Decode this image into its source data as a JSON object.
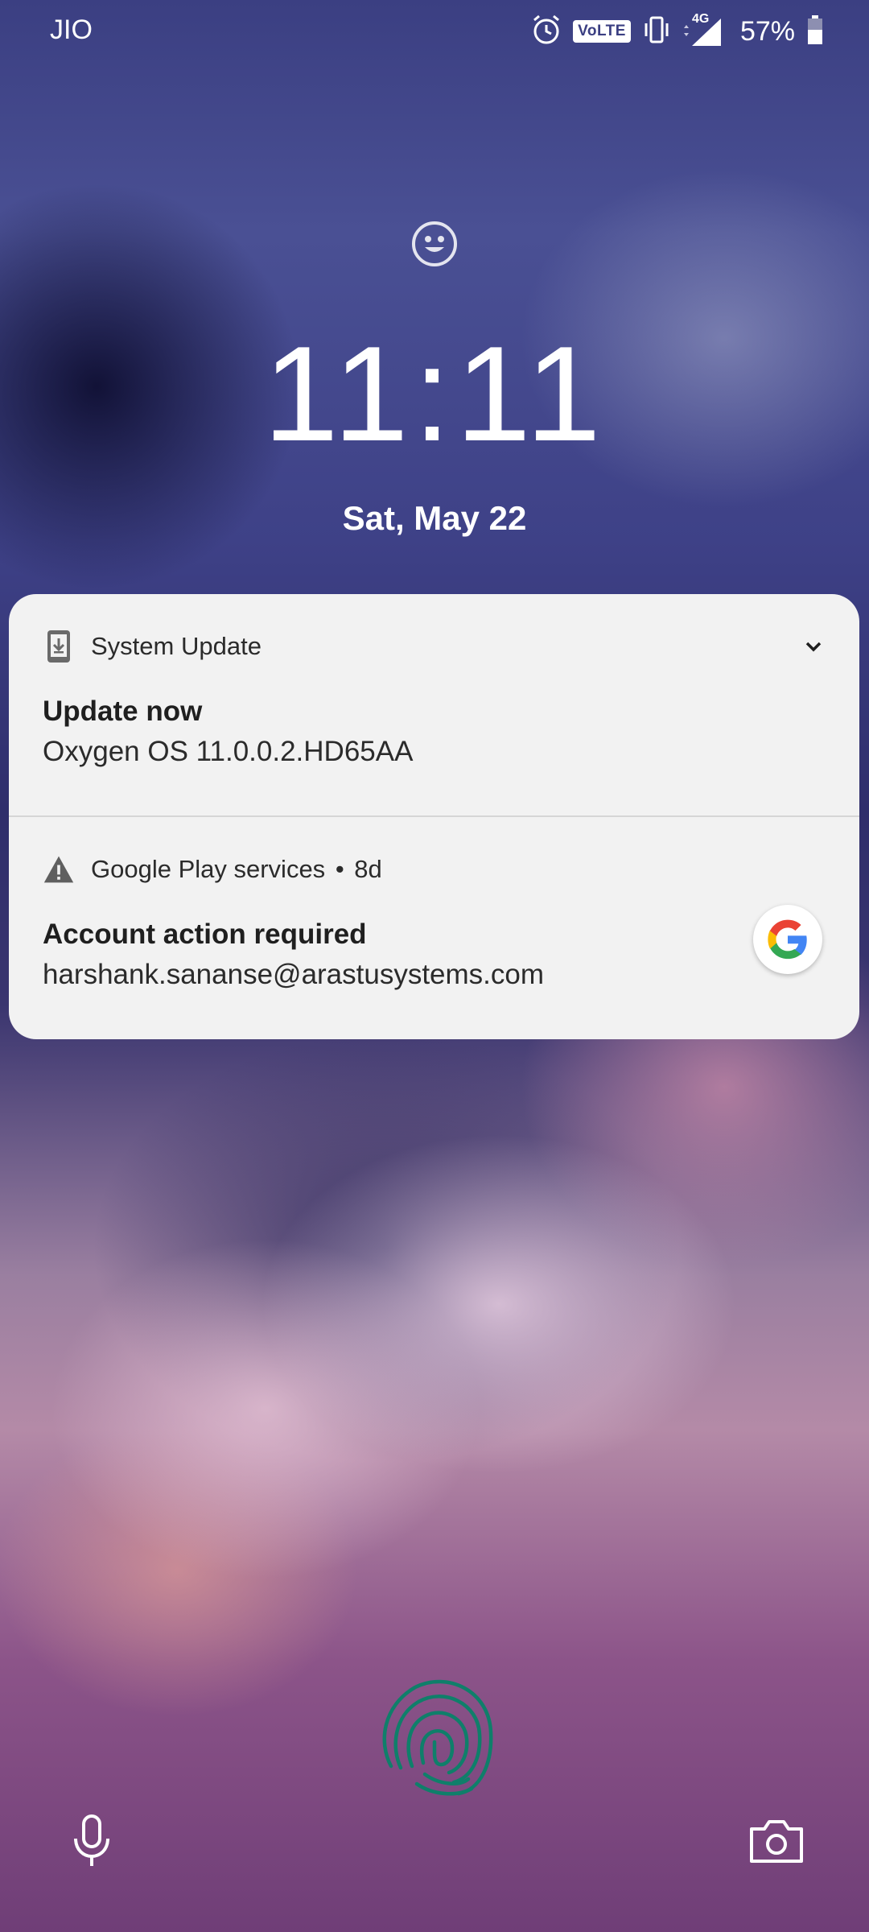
{
  "status_bar": {
    "carrier": "JIO",
    "icons": [
      "alarm-icon",
      "volte-icon",
      "vibrate-icon",
      "signal-4g-icon",
      "battery-icon"
    ],
    "volte_label": "VoLTE",
    "network_label": "4G",
    "battery_percent": "57%",
    "battery_level": 0.57
  },
  "lockscreen": {
    "time": "11:11",
    "date": "Sat, May 22"
  },
  "notifications": [
    {
      "app": "System Update",
      "app_icon": "system-update-icon",
      "title": "Update now",
      "text": "Oxygen OS 11.0.0.2.HD65AA"
    },
    {
      "app": "Google Play services",
      "separator": "•",
      "age": "8d",
      "app_icon": "warning-icon",
      "title": "Account action required",
      "text": "harshank.sananse@arastusystems.com",
      "avatar": "google-logo"
    }
  ],
  "bottom": {
    "left_icon": "mic-icon",
    "center_icon": "fingerprint-icon",
    "right_icon": "camera-icon",
    "fingerprint_color": "#0f7f6a"
  }
}
